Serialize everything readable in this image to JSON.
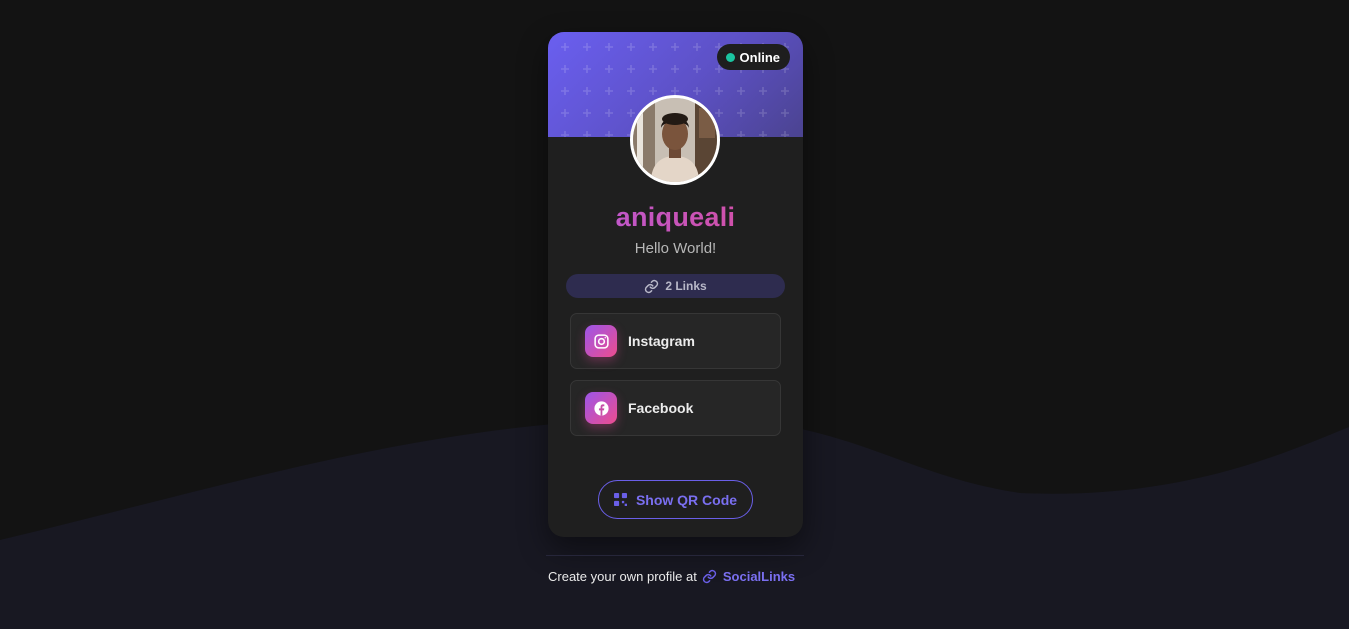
{
  "profile": {
    "status": "Online",
    "username": "aniqueali",
    "bio": "Hello World!",
    "links_count": "2 Links"
  },
  "links": [
    {
      "label": "Instagram",
      "icon": "instagram-icon"
    },
    {
      "label": "Facebook",
      "icon": "facebook-icon"
    }
  ],
  "qr_button": {
    "label": "Show QR Code",
    "icon": "qr-code-icon"
  },
  "footer": {
    "text": "Create your own profile at",
    "brand": "SocialLinks",
    "icon": "link-icon"
  },
  "colors": {
    "background": "#131313",
    "wave": "#181822",
    "card": "#1f1f1f",
    "accent": "#6a5fe8",
    "online": "#1bc4a0",
    "gradient_start": "#9c55e8",
    "gradient_end": "#ee4d8e"
  }
}
